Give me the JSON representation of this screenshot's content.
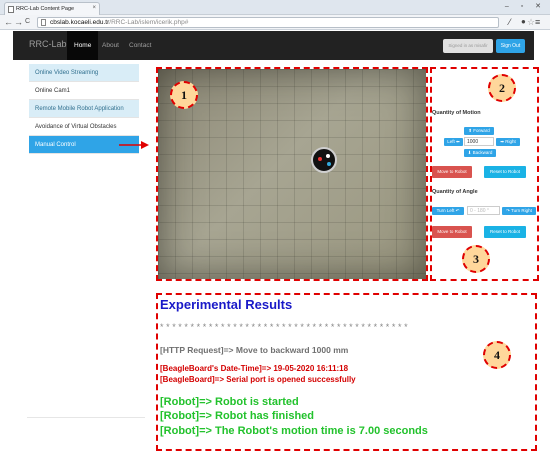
{
  "browser": {
    "tab_title": "RRC-Lab Content Page",
    "tab_close": "×",
    "window_controls": "– ▫ ✕",
    "url_host": "cbslab.kocaeli.edu.tr",
    "url_path": "/RRC-Lab/islem/icerik.php#",
    "back": "←",
    "forward": "→",
    "reload": "C",
    "star": "☆",
    "ext1": "⁄",
    "ext2": "●",
    "menu": "≡"
  },
  "navbar": {
    "brand": "RRC-Lab",
    "links": [
      {
        "label": "Home",
        "active": true
      },
      {
        "label": "About",
        "active": false
      },
      {
        "label": "Contact",
        "active": false
      }
    ],
    "signed_in": "Signed in as misafir",
    "sign_out": "Sign Out"
  },
  "sidebar": {
    "items": [
      {
        "label": "Online Video Streaming",
        "state": "highlight"
      },
      {
        "label": "Online Cam1",
        "state": "normal"
      },
      {
        "label": "Remote Mobile Robot Application",
        "state": "highlight"
      },
      {
        "label": "Avoidance of Virtual Obstacles",
        "state": "normal"
      },
      {
        "label": "Manual Control",
        "state": "active"
      }
    ]
  },
  "markers": {
    "one": "1",
    "two": "2",
    "three": "3",
    "four": "4"
  },
  "controls": {
    "motion_label": "Quantity of Motion",
    "forward": "⬆ Forward",
    "left": "Left ⬅",
    "distance_value": "1000",
    "right": "➡ Right",
    "backward": "⬇ Backward",
    "move_robot": "Move to Robot",
    "reset_robot": "Reset to Robot",
    "angle_label": "Quantity of Angle",
    "turn_left": "Turn Left ↶",
    "angle_placeholder": "0 - 180 °",
    "turn_right": "↷ Turn Right",
    "move_robot_2": "Move to Robot",
    "reset_robot_2": "Reset to Robot"
  },
  "results": {
    "title": "Experimental Results",
    "stars": "*****************************************",
    "http": "[HTTP Request]=> Move to backward 1000 mm",
    "bb_datetime": "[BeagleBoard's Date-Time]=> 19-05-2020 16:11:18",
    "bb_serial": "[BeagleBoard]=> Serial port is opened successfully",
    "robot_started": "[Robot]=> Robot is started",
    "robot_finished": "[Robot]=> Robot has finished",
    "robot_time": "[Robot]=> The Robot's motion time is 7.00 seconds"
  },
  "colors": {
    "navbar_bg": "#222222",
    "accent_blue": "#2fa4e7",
    "annotation_red": "#e00000",
    "result_title_blue": "#1919c8",
    "result_red": "#d40000",
    "result_green": "#22c22c"
  }
}
